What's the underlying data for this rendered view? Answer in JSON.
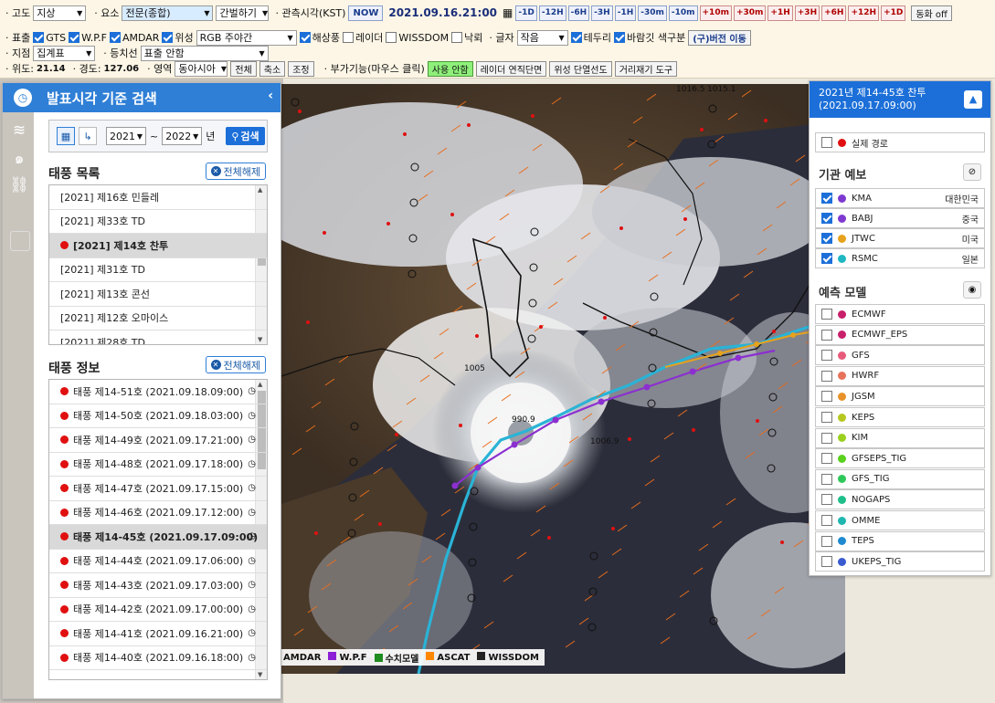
{
  "toolbar": {
    "row1": {
      "altitude_label": "· 고도",
      "altitude_value": "지상",
      "element_label": "· 요소",
      "element_value": "전문(종합)",
      "interval_value": "간벌하기",
      "obs_time_label": "· 관측시각(KST)",
      "now_label": "NOW",
      "datetime": "2021.09.16.21:00",
      "time_buttons": [
        "-1D",
        "-12H",
        "-6H",
        "-3H",
        "-1H",
        "-30m",
        "-10m",
        "+10m",
        "+30m",
        "+1H",
        "+3H",
        "+6H",
        "+12H",
        "+1D"
      ],
      "animation_label": "동화 off"
    },
    "row2": {
      "display_label": "· 표출",
      "gts": "GTS",
      "wpf": "W.P.F",
      "amdar": "AMDAR",
      "satellite": "위성",
      "rgb_value": "RGB 주야간",
      "sea_wind": "해상풍",
      "radar": "레이더",
      "wissdom": "WISSDOM",
      "lightning": "낙뢰",
      "font_label": "· 글자",
      "font_value": "작음",
      "border": "테두리",
      "wind_color": "바람깃 색구분",
      "old_version": "(구)버전 이동"
    },
    "row3": {
      "point_label": "· 지점",
      "point_value": "집계표",
      "contour_label": "· 등치선",
      "contour_value": "표출 안함"
    },
    "row4": {
      "lat_label": "· 위도:",
      "lat_value": "21.14",
      "lon_label": "· 경도:",
      "lon_value": "127.06",
      "region_label": "· 영역",
      "region_value": "동아시아",
      "btn_all": "전체",
      "btn_shrink": "축소",
      "btn_adjust": "조정",
      "extra_label": "· 부가기능(마우스 클릭)",
      "btn_disabled": "사용 안함",
      "btn_radar_section": "레이더 연직단면",
      "btn_sat_section": "위성 단열선도",
      "btn_distance": "거리재기 도구"
    }
  },
  "left_panel": {
    "title": "발표시각 기준 검색",
    "year_from": "2021",
    "year_to": "2022",
    "year_unit": "년",
    "search_label": "검색",
    "typhoon_list_title": "태풍 목록",
    "clear_label": "전체해제",
    "typhoon_list": [
      {
        "label": "[2021] 제16호 민들레",
        "selected": false
      },
      {
        "label": "[2021] 제33호 TD",
        "selected": false
      },
      {
        "label": "[2021] 제14호 찬투",
        "selected": true
      },
      {
        "label": "[2021] 제31호 TD",
        "selected": false
      },
      {
        "label": "[2021] 제13호 콘선",
        "selected": false
      },
      {
        "label": "[2021] 제12호 오마이스",
        "selected": false
      },
      {
        "label": "[2021] 제28호 TD",
        "selected": false
      }
    ],
    "typhoon_info_title": "태풍 정보",
    "typhoon_info": [
      {
        "label": "태풍 제14-51호 (2021.09.18.09:00)",
        "selected": false
      },
      {
        "label": "태풍 제14-50호 (2021.09.18.03:00)",
        "selected": false
      },
      {
        "label": "태풍 제14-49호 (2021.09.17.21:00)",
        "selected": false
      },
      {
        "label": "태풍 제14-48호 (2021.09.17.18:00)",
        "selected": false
      },
      {
        "label": "태풍 제14-47호 (2021.09.17.15:00)",
        "selected": false
      },
      {
        "label": "태풍 제14-46호 (2021.09.17.12:00)",
        "selected": false
      },
      {
        "label": "태풍 제14-45호 (2021.09.17.09:00)",
        "selected": true
      },
      {
        "label": "태풍 제14-44호 (2021.09.17.06:00)",
        "selected": false
      },
      {
        "label": "태풍 제14-43호 (2021.09.17.03:00)",
        "selected": false
      },
      {
        "label": "태풍 제14-42호 (2021.09.17.00:00)",
        "selected": false
      },
      {
        "label": "태풍 제14-41호 (2021.09.16.21:00)",
        "selected": false
      },
      {
        "label": "태풍 제14-40호 (2021.09.16.18:00)",
        "selected": false
      }
    ]
  },
  "legend": [
    {
      "label": "AMDAR",
      "color": "#c8c8e8"
    },
    {
      "label": "W.P.F",
      "color": "#8c1fd6"
    },
    {
      "label": "수치모델",
      "color": "#1f8c1f"
    },
    {
      "label": "ASCAT",
      "color": "#ff8800"
    },
    {
      "label": "WISSDOM",
      "color": "#222222"
    }
  ],
  "right_panel": {
    "title_line1": "2021년 제14-45호 찬투",
    "title_line2": "(2021.09.17.09:00)",
    "actual_track": "실제 경로",
    "agency_title": "기관 예보",
    "agencies": [
      {
        "name": "KMA",
        "country": "대한민국",
        "color": "#7e3ad0",
        "checked": true
      },
      {
        "name": "BABJ",
        "country": "중국",
        "color": "#7e3ad0",
        "checked": true
      },
      {
        "name": "JTWC",
        "country": "미국",
        "color": "#e6a21c",
        "checked": true
      },
      {
        "name": "RSMC",
        "country": "일본",
        "color": "#1fb7c4",
        "checked": true
      }
    ],
    "model_title": "예측 모델",
    "models": [
      {
        "name": "ECMWF",
        "color": "#c81f6a"
      },
      {
        "name": "ECMWF_EPS",
        "color": "#c81f6a"
      },
      {
        "name": "GFS",
        "color": "#e85a7a"
      },
      {
        "name": "HWRF",
        "color": "#e8735a"
      },
      {
        "name": "JGSM",
        "color": "#e8922a"
      },
      {
        "name": "KEPS",
        "color": "#b6c81f"
      },
      {
        "name": "KIM",
        "color": "#9bd01f"
      },
      {
        "name": "GFSEPS_TIG",
        "color": "#5ad01f"
      },
      {
        "name": "GFS_TIG",
        "color": "#2ec85a"
      },
      {
        "name": "NOGAPS",
        "color": "#1fbf8c"
      },
      {
        "name": "OMME",
        "color": "#1fb7b0"
      },
      {
        "name": "TEPS",
        "color": "#1f8ad0"
      },
      {
        "name": "UKEPS_TIG",
        "color": "#3a5ad0"
      }
    ]
  },
  "map": {
    "map_labels": [
      "1016.5",
      "1015.1",
      "1005",
      "1006.9",
      "990.9"
    ]
  }
}
